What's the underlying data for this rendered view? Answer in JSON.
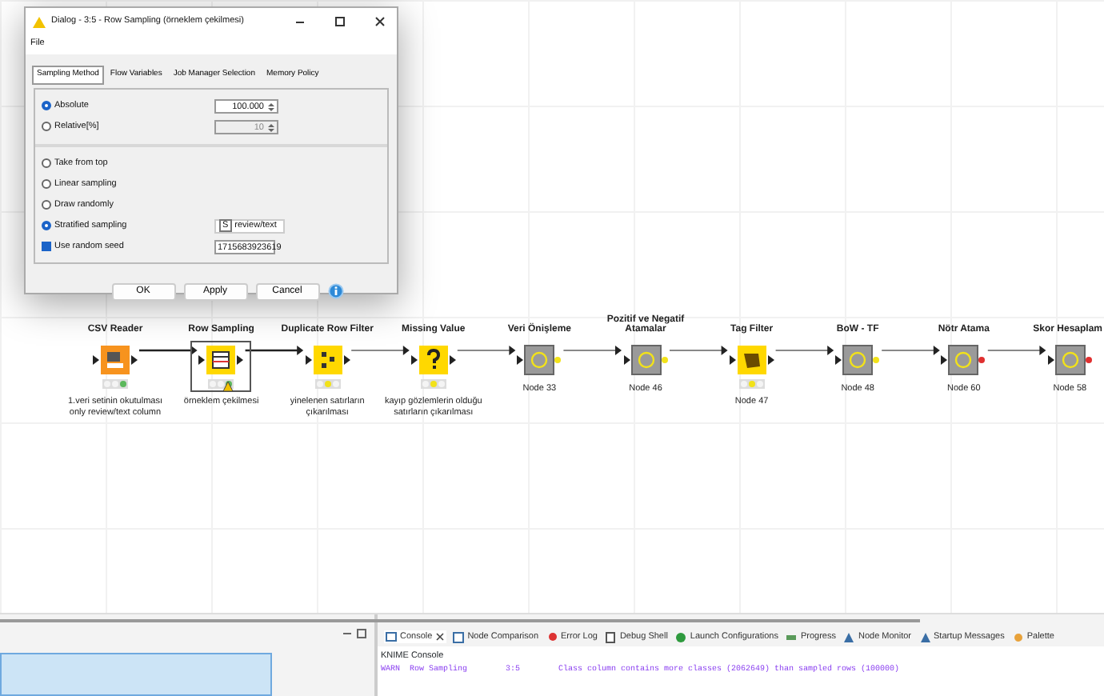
{
  "dialog": {
    "title": "Dialog - 3:5 - Row Sampling (örneklem çekilmesi)",
    "menu": [
      "File"
    ],
    "tabs": [
      {
        "label": "Sampling Method",
        "selected": true
      },
      {
        "label": "Flow Variables",
        "selected": false
      },
      {
        "label": "Job Manager Selection",
        "selected": false
      },
      {
        "label": "Memory Policy",
        "selected": false
      }
    ],
    "sections": [
      {
        "options": [
          {
            "kind": "radio",
            "label": "Absolute",
            "selected": true,
            "value": "100.000",
            "disabled": false
          },
          {
            "kind": "radio",
            "label": "Relative[%]",
            "selected": false,
            "value": "10",
            "disabled": true
          }
        ]
      },
      {
        "options": [
          {
            "kind": "radio",
            "label": "Take from top",
            "selected": false
          },
          {
            "kind": "radio",
            "label": "Linear sampling",
            "selected": false
          },
          {
            "kind": "radio",
            "label": "Draw randomly",
            "selected": false
          },
          {
            "kind": "select",
            "label": "Stratified sampling",
            "selected": true,
            "value": "review/text",
            "type_badge": "S"
          },
          {
            "kind": "checkbox",
            "label": "Use random seed",
            "checked": true,
            "value": "1715683923619"
          }
        ]
      }
    ],
    "buttons": [
      "OK",
      "Apply",
      "Cancel"
    ]
  },
  "nodes": [
    {
      "kind": "source",
      "title": "CSV Reader",
      "annotation": "1.veri setinin okutulması only review/text column",
      "executed": true,
      "selected": false
    },
    {
      "kind": "manipulator",
      "title": "Row Sampling",
      "annotation": "örneklem çekilmesi",
      "executed": true,
      "warning": true,
      "selected": true
    },
    {
      "kind": "manipulator",
      "title": "Duplicate Row Filter",
      "annotation": "yinelenen satırların çıkarılması",
      "executed": false,
      "selected": false
    },
    {
      "kind": "missing",
      "title": "Missing Value",
      "annotation": "kayıp gözlemlerin olduğu satırların çıkarılması",
      "executed": false,
      "selected": false
    },
    {
      "kind": "metanode",
      "title": "Veri Önişleme",
      "annotation": "Node 33",
      "color": "#f2e21a",
      "selected": false
    },
    {
      "kind": "metanode",
      "title": "Pozitif ve Negatif Atamalar",
      "annotation": "Node 46",
      "color": "#f2e21a",
      "selected": false
    },
    {
      "kind": "tagger",
      "title": "Tag Filter",
      "annotation": "Node 47",
      "executed": false,
      "selected": false
    },
    {
      "kind": "metanode",
      "title": "BoW - TF",
      "annotation": "Node 48",
      "color": "#f2e21a",
      "selected": false
    },
    {
      "kind": "metanode",
      "title": "Nötr Atama",
      "annotation": "Node 60",
      "color": "#e03030",
      "selected": false
    },
    {
      "kind": "metanode",
      "title": "Skor Hesaplam",
      "annotation": "Node 58",
      "color": "#e03030",
      "selected": false
    }
  ],
  "console": {
    "tabs": [
      {
        "label": "Console",
        "selected": true
      },
      {
        "label": "Node Comparison",
        "selected": false
      },
      {
        "label": "Error Log",
        "selected": false
      },
      {
        "label": "Debug Shell",
        "selected": false
      },
      {
        "label": "Launch Configurations",
        "selected": false
      },
      {
        "label": "Progress",
        "selected": false
      },
      {
        "label": "Node Monitor",
        "selected": false
      },
      {
        "label": "Startup Messages",
        "selected": false
      },
      {
        "label": "Palette",
        "selected": false
      }
    ],
    "title": "KNIME Console",
    "lines": [
      "WARN  Row Sampling        3:5        Class column contains more classes (2062649) than sampled rows (100000)"
    ]
  }
}
